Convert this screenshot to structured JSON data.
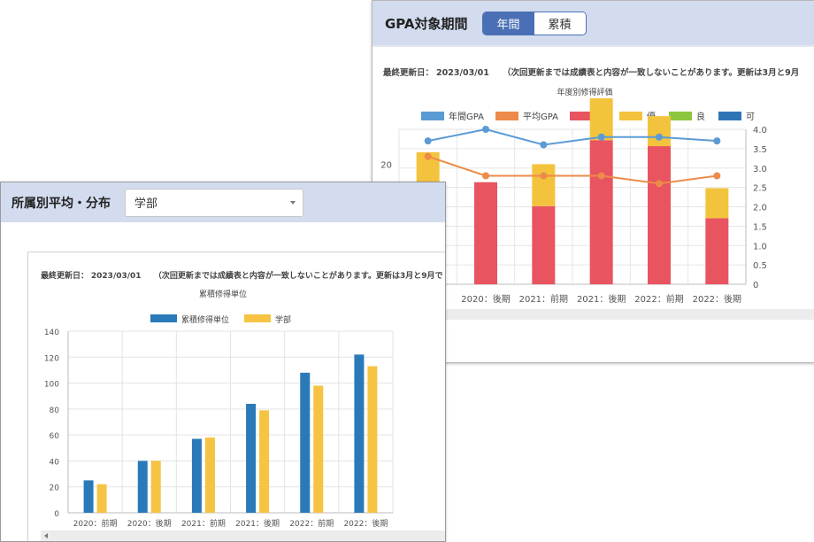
{
  "gpa_panel": {
    "title": "GPA対象期間",
    "tabs": [
      {
        "label": "年間",
        "active": true
      },
      {
        "label": "累積",
        "active": false
      }
    ],
    "updated_label": "最終更新日：",
    "updated_date": "2023/03/01",
    "notice": "（次回更新までは成績表と内容が一致しないことがあります。更新は3月と9月",
    "chart_title": "年度別修得評価"
  },
  "dept_panel": {
    "title": "所属別平均・分布",
    "select_value": "学部",
    "updated_label": "最終更新日：",
    "updated_date": "2023/03/01",
    "notice": "（次回更新までは成績表と内容が一致しないことがあります。更新は3月と9月で",
    "chart_title": "累積修得単位"
  },
  "chart_data": [
    {
      "type": "bar",
      "title": "年度別修得評価",
      "categories": [
        "2020：前期",
        "2020：後期",
        "2021：前期",
        "2021：後期",
        "2022：前期",
        "2022：後期"
      ],
      "category_labels_visible": [
        "前期",
        "2020：後期",
        "2021：前期",
        "2021：後期",
        "2022：前期",
        "2022：後期"
      ],
      "stacked": true,
      "series": [
        {
          "name": "年間GPA",
          "type": "line",
          "axis": "right",
          "color": "#5b9bd5",
          "values": [
            3.7,
            4.0,
            3.6,
            3.8,
            3.8,
            3.7
          ]
        },
        {
          "name": "平均GPA",
          "type": "line",
          "axis": "right",
          "color": "#ed8b4a",
          "values": [
            3.3,
            2.8,
            2.8,
            2.8,
            2.6,
            2.8
          ]
        },
        {
          "name": "秀",
          "type": "bar",
          "axis": "left",
          "color": "#e8545f",
          "values": [
            12,
            17,
            13,
            24,
            23,
            11
          ]
        },
        {
          "name": "優",
          "type": "bar",
          "axis": "left",
          "color": "#f4c33d",
          "values": [
            10,
            0,
            7,
            7,
            5,
            5
          ]
        },
        {
          "name": "良",
          "type": "bar",
          "axis": "left",
          "color": "#8cc63e",
          "values": [
            0,
            0,
            0,
            0,
            0,
            0
          ]
        },
        {
          "name": "可",
          "type": "bar",
          "axis": "left",
          "color": "#2e75b6",
          "values": [
            0,
            0,
            0,
            0,
            0,
            0
          ]
        }
      ],
      "left_ticks": [
        "20"
      ],
      "right_ylim": [
        0,
        4.0
      ],
      "right_ticks": [
        "0",
        "0.5",
        "1.0",
        "1.5",
        "2.0",
        "2.5",
        "3.0",
        "3.5",
        "4.0"
      ],
      "legend_position": "top",
      "grid": true
    },
    {
      "type": "bar",
      "title": "累積修得単位",
      "categories": [
        "2020：前期",
        "2020：後期",
        "2021：前期",
        "2021：後期",
        "2022：前期",
        "2022：後期"
      ],
      "series": [
        {
          "name": "累積修得単位",
          "color": "#2a7ab9",
          "values": [
            25,
            40,
            57,
            84,
            108,
            122
          ]
        },
        {
          "name": "学部",
          "color": "#f6c342",
          "values": [
            22,
            40,
            58,
            79,
            98,
            113
          ]
        }
      ],
      "ylim": [
        0,
        140
      ],
      "y_ticks": [
        "0",
        "20",
        "40",
        "60",
        "80",
        "100",
        "120",
        "140"
      ],
      "legend_position": "top",
      "grid": true
    }
  ]
}
